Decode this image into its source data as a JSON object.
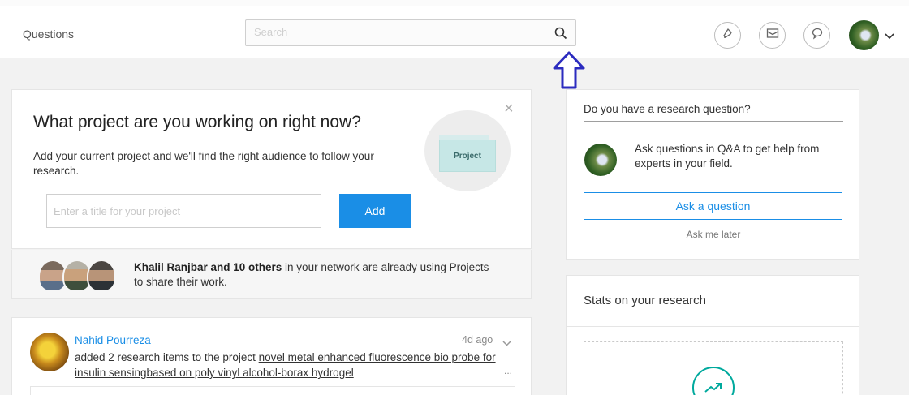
{
  "topbar": {
    "title": "Questions",
    "search_placeholder": "Search",
    "icons": [
      "search-icon",
      "bell-icon",
      "mail-icon",
      "chat-icon",
      "chevron-down-icon"
    ]
  },
  "project_prompt": {
    "title": "What project are you working on right now?",
    "description": "Add your current project and we'll find the right audience to follow your research.",
    "illustration_label": "Project",
    "input_placeholder": "Enter a title for your project",
    "add_label": "Add",
    "close_glyph": "×"
  },
  "network": {
    "names": "Khalil Ranjbar and 10 others",
    "rest": " in your network are already using Projects to share their work."
  },
  "feed": {
    "author": "Nahid Pourreza",
    "time": "4d ago",
    "action": "added 2 research items to the project ",
    "project_link": "novel metal enhanced fluorescence bio probe for insulin sensingbased on poly vinyl alcohol-borax hydrogel",
    "more": "..."
  },
  "research_question": {
    "title": "Do you have a research question?",
    "text": "Ask questions in Q&A to get help from experts in your field.",
    "ask_label": "Ask a question",
    "later_label": "Ask me later"
  },
  "stats": {
    "title": "Stats on your research"
  },
  "colors": {
    "accent": "#1a8ee6",
    "teal": "#00a99d",
    "arrow": "#2b2bbf"
  }
}
